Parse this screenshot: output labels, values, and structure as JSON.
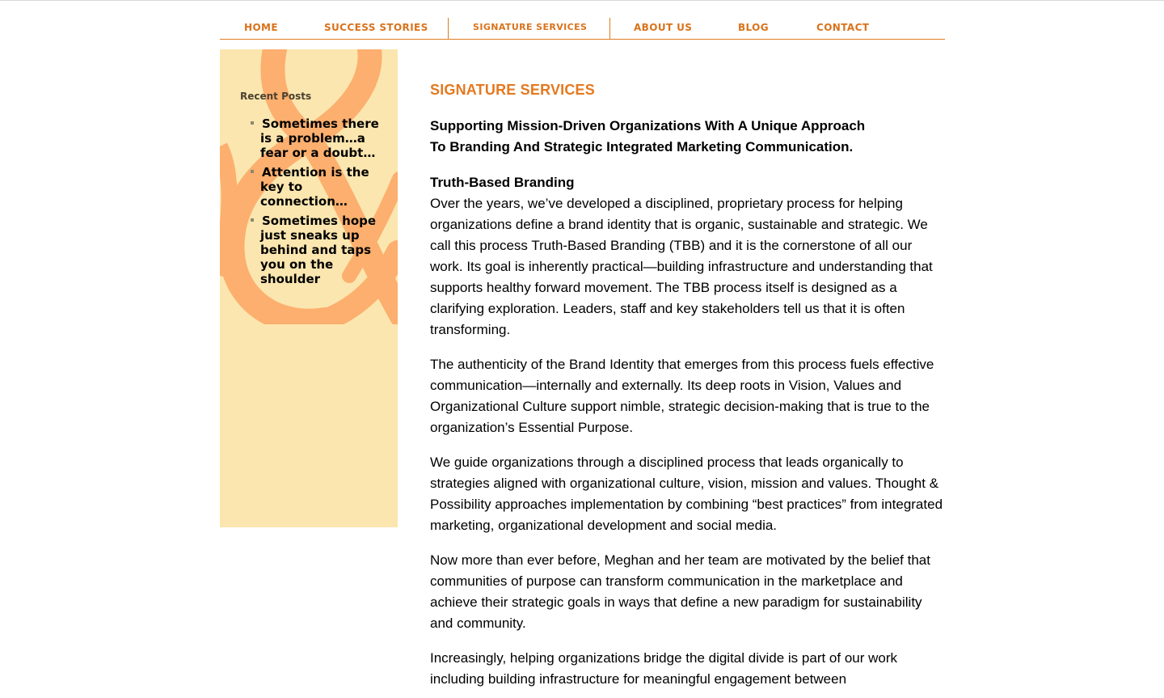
{
  "nav": {
    "items": [
      {
        "label": "HOME"
      },
      {
        "label": "SUCCESS STORIES"
      },
      {
        "label": "SIGNATURE SERVICES"
      },
      {
        "label": "ABOUT US"
      },
      {
        "label": "BLOG"
      },
      {
        "label": "CONTACT"
      }
    ],
    "active": "SIGNATURE SERVICES",
    "color": "#d9731c"
  },
  "sidebar": {
    "heading": "Recent Posts",
    "posts": [
      {
        "title": "Sometimes there is a problem…a fear or a doubt…"
      },
      {
        "title": "Attention is the key to connection…"
      },
      {
        "title": "Sometimes hope just sneaks up behind and taps you on the shoulder"
      }
    ],
    "background": "#fbe6af",
    "art_color": "#fcaf6e",
    "art_icon": "ampersand-graphic"
  },
  "main": {
    "title": "SIGNATURE SERVICES",
    "intro_line1": "Supporting Mission-Driven Organizations With A Unique Approach",
    "intro_line2": "To Branding And Strategic Integrated Marketing Communication.",
    "section_title": "Truth-Based Branding",
    "paragraphs": [
      "Over the years, we’ve developed a disciplined, proprietary process for helping organizations define a brand identity that is organic, sustainable and strategic. We call this process Truth-Based Branding (TBB) and it is the cornerstone of all our work. Its goal is inherently practical—building infrastructure and understanding that supports healthy forward movement. The TBB process itself is designed as a clarifying exploration. Leaders, staff and key stakeholders tell us that it is often transforming.",
      "The authenticity of the Brand Identity that emerges from this process fuels effective communication—internally and externally. Its deep roots in Vision, Values and Organizational Culture support nimble, strategic decision-making that is true to the organization’s Essential Purpose.",
      "We guide organizations through a disciplined process that leads organically to strategies aligned with organizational culture, vision, mission and values. Thought & Possibility approaches implementation by combining “best practices” from integrated marketing, organizational development and social media.",
      "Now more than ever before, Meghan and her team are motivated by the belief that communities of purpose can transform communication in the marketplace and achieve their strategic goals in ways that define a new paradigm for sustainability and community.",
      "Increasingly, helping organizations bridge the digital divide is part of our work including building infrastructure for meaningful engagement between"
    ],
    "title_color": "#e4791f"
  }
}
